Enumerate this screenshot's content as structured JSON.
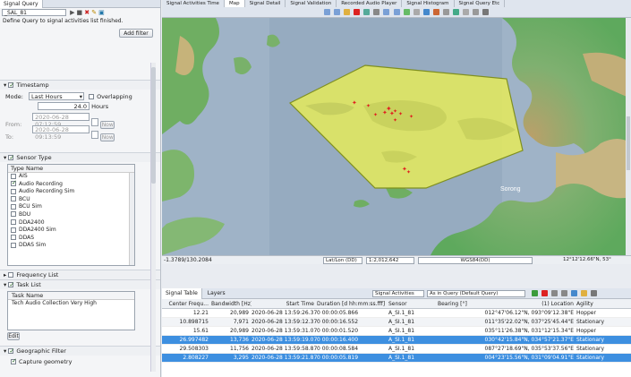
{
  "left": {
    "tab_label": "Signal Query",
    "query_select": "_SAL_81",
    "info_text": "Define Query to signal activities list finished.",
    "add_filter_label": "Add filter",
    "timestamp": {
      "title": "Timestamp",
      "mode_label": "Mode:",
      "mode_value": "Last Hours",
      "overlapping_label": "Overlapping",
      "hours_value": "24.0",
      "hours_label": "Hours",
      "from_label": "From:",
      "from_value": "2020-06-28 07:12:59",
      "to_label": "To:",
      "to_value": "2020-06-28 09:13:59",
      "now_label": "Now"
    },
    "sensor_type": {
      "title": "Sensor Type",
      "column": "Type Name",
      "items": [
        {
          "label": "AIS",
          "checked": false
        },
        {
          "label": "Audio Recording",
          "checked": true
        },
        {
          "label": "Audio Recording Sim",
          "checked": false
        },
        {
          "label": "BCU",
          "checked": false
        },
        {
          "label": "BCU Sim",
          "checked": false
        },
        {
          "label": "BDU",
          "checked": false
        },
        {
          "label": "DDA2400",
          "checked": false
        },
        {
          "label": "DDA2400 Sim",
          "checked": false
        },
        {
          "label": "DDAS",
          "checked": false
        },
        {
          "label": "DDAS Sim",
          "checked": false
        }
      ]
    },
    "frequency_list": {
      "title": "Frequency List"
    },
    "task_list": {
      "title": "Task List",
      "column": "Task Name",
      "row": "Tech Audio Collection Very High",
      "edit_label": "Edit"
    },
    "geo_filter": {
      "title": "Geographic Filter",
      "capture_label": "Capture geometry"
    }
  },
  "top_tabs": [
    "Signal Activities Time",
    "Map",
    "Signal Detail",
    "Signal Validation",
    "Recorded Audio Player",
    "Signal Histogram",
    "Signal Query Etc"
  ],
  "map": {
    "place_label": "Sorong"
  },
  "coordbar": {
    "coord_left": "-1.3789/130.2084",
    "crs": "Lat/Lon (DD)",
    "scale": "1:2,012,642",
    "datum": "WGS84(DD)",
    "coord_right": "12°12'12.66\"N, 53°"
  },
  "table": {
    "tab_signal": "Signal Table",
    "tab_layers": "Layers",
    "activities_select": "Signal Activities",
    "query_select": "As in Query (Default Query)",
    "columns": [
      "Center Frequ...",
      "Bandwidth [Hz]",
      "Start Time",
      "Duration [d hh:mm:ss.fff]",
      "Sensor",
      "Bearing [°]",
      "(1) Location",
      "Agility"
    ],
    "rows": [
      [
        "12.21",
        "20,989",
        "2020-06-28 13:59:26.376",
        "0 00:00:05.866",
        "A_SI.1_81",
        "",
        "012°47'06.12\"N, 093°09'12.38\"E",
        "Hopper"
      ],
      [
        "10.898715",
        "7,971",
        "2020-06-28 13:59:12.375",
        "0 00:00:16.552",
        "A_SI.1_81",
        "",
        "011°35'22.02\"N, 037°25'45.44\"E",
        "Stationary"
      ],
      [
        "15.61",
        "20,989",
        "2020-06-28 13:59:31.075",
        "0 00:00:01.520",
        "A_SI.1_81",
        "",
        "035°11'26.38\"N, 031°12'15.34\"E",
        "Hopper"
      ],
      [
        "26.997482",
        "13,736",
        "2020-06-28 13:59:19.075",
        "0 00:00:16.400",
        "A_SI.1_81",
        "",
        "030°42'15.84\"N, 034°57'21.37\"E",
        "Stationary"
      ],
      [
        "29.508303",
        "11,756",
        "2020-06-28 13:59:58.875",
        "0 00:00:08.584",
        "A_SI.1_81",
        "",
        "087°27'18.69\"N, 035°53'37.56\"E",
        "Stationary"
      ],
      [
        "2.808227",
        "3,295",
        "2020-06-28 13:59:21.875",
        "0 00:00:05.819",
        "A_SI.1_81",
        "",
        "004°23'15.56\"N, 031°09'04.91\"E",
        "Stationary"
      ]
    ],
    "selected_rows": [
      3,
      5
    ]
  },
  "colors": {
    "selection": "#3d8fe0",
    "polygon_fill": "#e5ea5a",
    "sea": "#9fb3c7",
    "marker": "#e02020"
  }
}
